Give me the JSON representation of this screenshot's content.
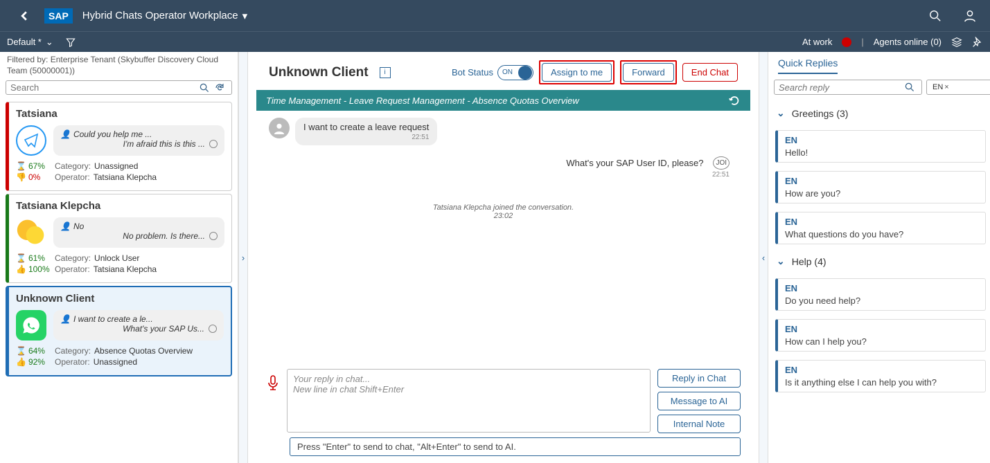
{
  "header": {
    "app_title": "Hybrid Chats Operator Workplace",
    "default_label": "Default *",
    "at_work": "At work",
    "agents_online": "Agents online (0)"
  },
  "left": {
    "filter_text": "Filtered by: Enterprise Tenant (Skybuffer Discovery Cloud Team (50000001))",
    "search_placeholder": "Search",
    "chats": [
      {
        "name": "Tatsiana",
        "req": "Could you help me ...",
        "resp": "I'm afraid this is this ...",
        "m1": "67%",
        "m2": "0%",
        "category": "Unassigned",
        "operator": "Tatsiana Klepcha"
      },
      {
        "name": "Tatsiana Klepcha",
        "req": "No",
        "resp": "No problem. Is there...",
        "m1": "61%",
        "m2": "100%",
        "category": "Unlock User",
        "operator": "Tatsiana Klepcha"
      },
      {
        "name": "Unknown Client",
        "req": "I want to create a le...",
        "resp": "What's your SAP Us...",
        "m1": "64%",
        "m2": "92%",
        "category": "Absence Quotas Overview",
        "operator": "Unassigned"
      }
    ],
    "cat_label": "Category:",
    "op_label": "Operator:"
  },
  "center": {
    "client": "Unknown Client",
    "bot_status_label": "Bot Status",
    "toggle_state": "ON",
    "assign_btn": "Assign to me",
    "forward_btn": "Forward",
    "end_btn": "End Chat",
    "breadcrumb": "Time Management - Leave Request Management - Absence Quotas Overview",
    "msg1": "I want to create a leave request",
    "msg1_time": "22:51",
    "msg2": "What's your SAP User ID, please?",
    "msg2_time": "22:51",
    "bot_label": "JOI",
    "sys_msg": "Tatsiana Klepcha joined the conversation.",
    "sys_time": "23:02",
    "reply_ph1": "Your reply in chat...",
    "reply_ph2": "New line in chat Shift+Enter",
    "btn_reply": "Reply in Chat",
    "btn_msg_ai": "Message to AI",
    "btn_note": "Internal Note",
    "hint": "Press \"Enter\" to send to chat, \"Alt+Enter\" to send to AI."
  },
  "right": {
    "tab": "Quick Replies",
    "search_ph": "Search reply",
    "lang": "EN",
    "groups": [
      {
        "title": "Greetings (3)",
        "items": [
          {
            "lang": "EN",
            "text": "Hello!"
          },
          {
            "lang": "EN",
            "text": "How are you?"
          },
          {
            "lang": "EN",
            "text": "What questions do you have?"
          }
        ]
      },
      {
        "title": "Help (4)",
        "items": [
          {
            "lang": "EN",
            "text": "Do you need help?"
          },
          {
            "lang": "EN",
            "text": "How can I help you?"
          },
          {
            "lang": "EN",
            "text": "Is it anything else I can help you with?"
          }
        ]
      }
    ]
  }
}
